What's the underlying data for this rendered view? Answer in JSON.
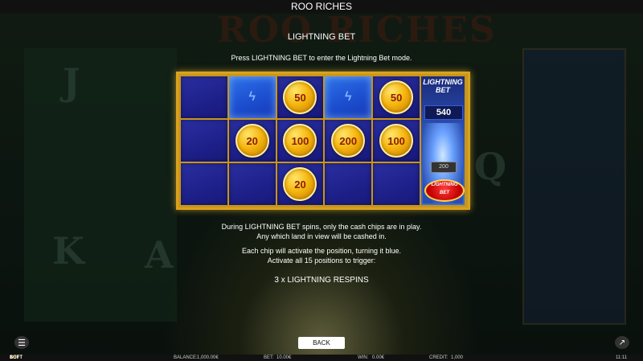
{
  "window": {
    "title": "ROO RICHES"
  },
  "background": {
    "title_text": "ROO RICHES",
    "glyph_j": "J",
    "glyph_k": "K",
    "glyph_a": "A",
    "glyph_q": "Q"
  },
  "help": {
    "heading": "LIGHTNING BET",
    "instruction": "Press LIGHTNING BET to enter the Lightning Bet mode.",
    "paragraph1_line1": "During LIGHTNING BET spins, only the cash chips are in play.",
    "paragraph1_line2": "Any which land in view will be cashed in.",
    "paragraph2_line1": "Each chip will activate the position, turning it blue.",
    "paragraph2_line2": "Activate all 15 positions to trigger:",
    "trigger": "3 x LIGHTNING RESPINS"
  },
  "grid": {
    "cells": [
      {
        "type": "empty"
      },
      {
        "type": "active"
      },
      {
        "type": "chip",
        "value": "50"
      },
      {
        "type": "active"
      },
      {
        "type": "chip",
        "value": "50"
      },
      {
        "type": "empty"
      },
      {
        "type": "chip",
        "value": "20"
      },
      {
        "type": "chip",
        "value": "100"
      },
      {
        "type": "chip",
        "value": "200"
      },
      {
        "type": "chip",
        "value": "100"
      },
      {
        "type": "empty"
      },
      {
        "type": "empty"
      },
      {
        "type": "chip",
        "value": "20"
      },
      {
        "type": "empty"
      },
      {
        "type": "empty"
      }
    ]
  },
  "side_panel": {
    "logo_line1": "LIGHTNING",
    "logo_line2": "BET",
    "value": "540",
    "mini_value": "200",
    "badge_line1": "LIGHTNING",
    "badge_line2": "BET"
  },
  "controls": {
    "back_label": "BACK"
  },
  "statusbar": {
    "brand_prefix": "1",
    "brand_soft": "SOFT",
    "brand_bet": "BET",
    "balance_label": "BALANCE:",
    "balance_value": "1,000.00€",
    "bet_label": "BET:",
    "bet_value": "10.00€",
    "win_label": "WIN:",
    "win_value": "0.00€",
    "credit_label": "CREDIT:",
    "credit_value": "1,000",
    "time": "11:11"
  },
  "colors": {
    "frame": "#d9a21e",
    "cell_inactive": "#1e208a",
    "cell_active": "#1c4fd0",
    "chip": "#f5b70f",
    "accent": "#f5a21e"
  }
}
